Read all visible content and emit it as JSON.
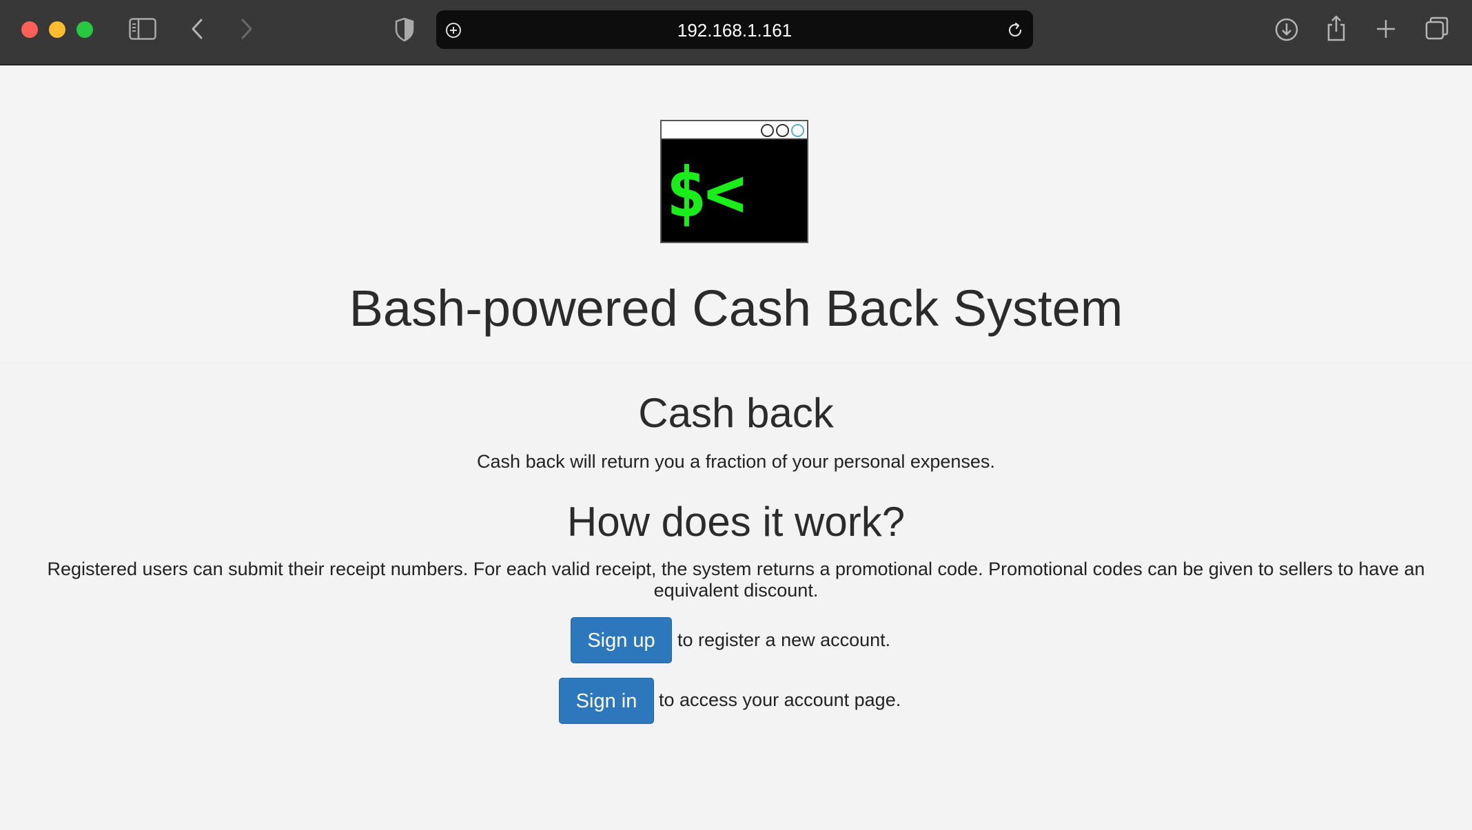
{
  "browser": {
    "url": "192.168.1.161",
    "icons": [
      "sidebar-icon",
      "back-arrow-icon",
      "forward-arrow-icon",
      "shield-icon",
      "site-settings-icon",
      "reload-icon",
      "download-icon",
      "share-icon",
      "new-tab-plus-icon",
      "tab-overview-icon"
    ]
  },
  "logo": {
    "prompt": "$<",
    "prompt_color": "#1aee1a",
    "window_buttons": 3
  },
  "page": {
    "title": "Bash-powered Cash Back System",
    "cash_back": {
      "heading": "Cash back",
      "text": "Cash back will return you a fraction of your personal expenses."
    },
    "how": {
      "heading": "How does it work?",
      "text": "Registered users can submit their receipt numbers. For each valid receipt, the system returns a promotional code. Promotional codes can be given to sellers to have an equivalent discount."
    },
    "actions": {
      "signup_label": "Sign up",
      "signup_text": "to register a new account.",
      "signin_label": "Sign in",
      "signin_text": "to access your account page."
    }
  },
  "colors": {
    "chrome": "#383838",
    "url_field": "#0d0d0d",
    "page_bg": "#f3f3f3",
    "button": "#2d78bd",
    "close": "#fe5f57",
    "minimize": "#febc2e",
    "maximize": "#28c840"
  }
}
